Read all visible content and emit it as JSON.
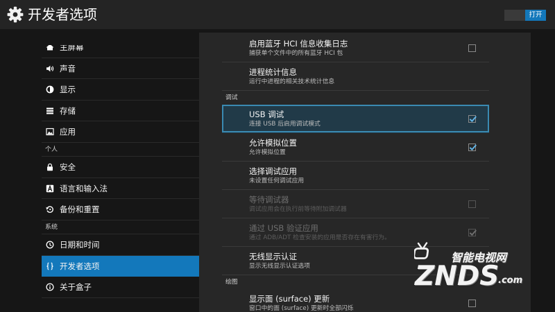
{
  "theme": {
    "accent": "#1378bb",
    "focus_bg": "#213a48",
    "focus_border": "#3a8ab2",
    "check": "#62b6e8"
  },
  "header": {
    "icon": "gear-icon",
    "title": "开发者选项",
    "toggle_label": "打开",
    "toggle_on": true
  },
  "sidebar": {
    "sections": [
      {
        "items": [
          {
            "icon": "home-icon",
            "label": "主屏幕"
          },
          {
            "icon": "speaker-icon",
            "label": "声音"
          },
          {
            "icon": "brightness-icon",
            "label": "显示"
          },
          {
            "icon": "storage-icon",
            "label": "存储"
          },
          {
            "icon": "apps-icon",
            "label": "应用"
          }
        ]
      },
      {
        "header": "个人",
        "items": [
          {
            "icon": "lock-icon",
            "label": "安全"
          },
          {
            "icon": "language-icon",
            "label": "语言和输入法"
          },
          {
            "icon": "restore-icon",
            "label": "备份和重置"
          }
        ]
      },
      {
        "header": "系统",
        "items": [
          {
            "icon": "clock-icon",
            "label": "日期和时间"
          },
          {
            "icon": "braces-icon",
            "label": "开发者选项",
            "selected": true
          },
          {
            "icon": "info-icon",
            "label": "关于盒子"
          }
        ]
      }
    ]
  },
  "preferences": {
    "sections": [
      {
        "items": [
          {
            "title": "启用蓝牙 HCI 信息收集日志",
            "summary": "捕获单个文件中的所有蓝牙 HCI 包",
            "checked": false
          },
          {
            "title": "进程统计信息",
            "summary": "运行中进程的相关技术统计信息"
          }
        ]
      },
      {
        "header": "调试",
        "items": [
          {
            "title": "USB 调试",
            "summary": "连接 USB 后启用调试模式",
            "checked": true,
            "focused": true
          },
          {
            "title": "允许模拟位置",
            "summary": "允许模拟位置",
            "checked": true
          },
          {
            "title": "选择调试应用",
            "summary": "未设置任何调试应用"
          },
          {
            "title": "等待调试器",
            "summary": "调试应用会在执行前等待附加调试器",
            "checked": false,
            "disabled": true
          },
          {
            "title": "通过 USB 验证应用",
            "summary": "通过 ADB/ADT 检查安装的应用是否存在有害行为。",
            "checked": true,
            "disabled": true
          },
          {
            "title": "无线显示认证",
            "summary": "显示无线显示认证选项"
          }
        ]
      },
      {
        "header": "绘图",
        "items": [
          {
            "title": "显示面 (surface) 更新",
            "summary": "窗口中的面 (surface) 更新时全部闪烁",
            "checked": false
          }
        ]
      }
    ]
  },
  "watermark": {
    "icon": "tv-antenna-icon",
    "tagline": "智能电视网",
    "brand": "ZNDS",
    "suffix": ".com"
  }
}
